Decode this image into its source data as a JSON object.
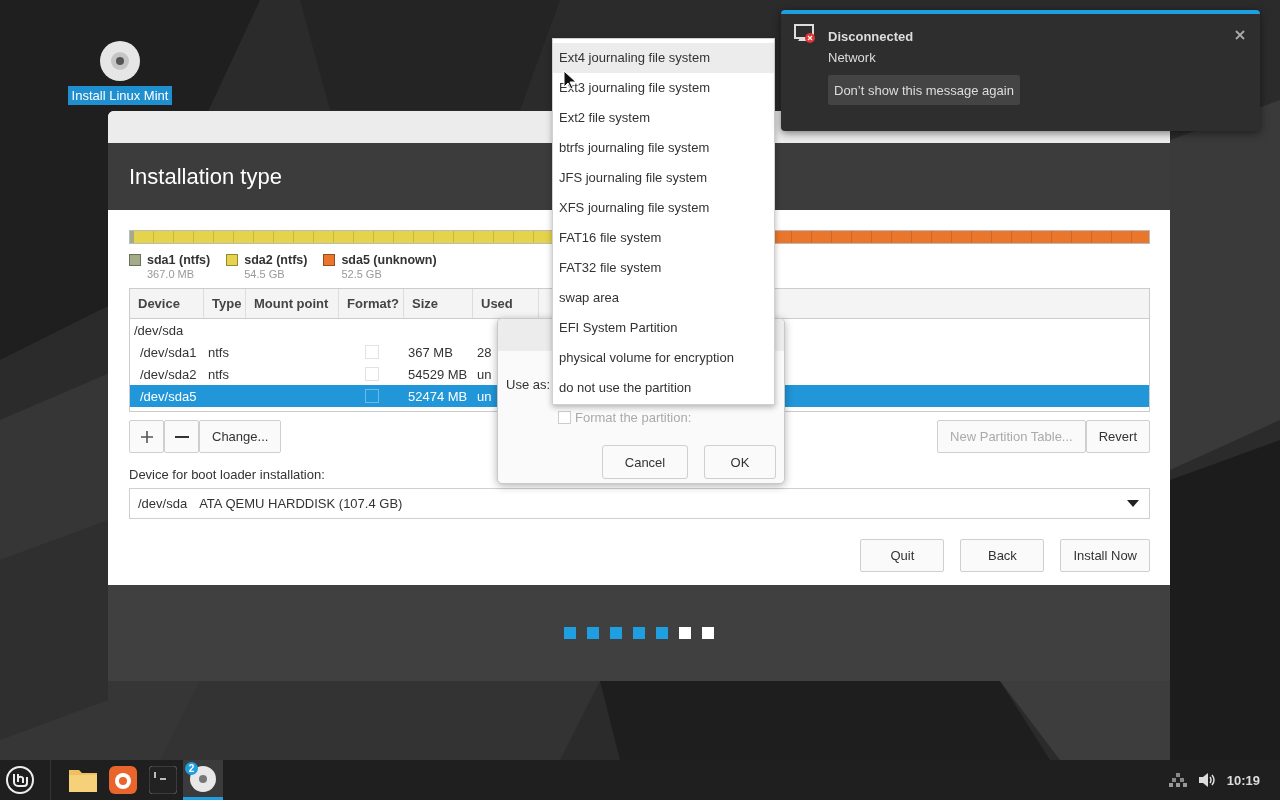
{
  "desktop_icon": {
    "label": "Install Linux Mint",
    "selected": true
  },
  "installer": {
    "title": "Installation type",
    "partitions": [
      {
        "name": "sda1 (ntfs)",
        "size": "367.0 MB",
        "color": "#a4ab8b",
        "level": 0.004
      },
      {
        "name": "sda2 (ntfs)",
        "size": "54.5 GB",
        "color": "#e4d34b",
        "level": 0.508
      },
      {
        "name": "sda5 (unknown)",
        "size": "52.5 GB",
        "color": "#e9762b",
        "level": 0.488
      }
    ],
    "table": {
      "columns": [
        "Device",
        "Type",
        "Mount point",
        "Format?",
        "Size",
        "Used"
      ],
      "rows": [
        {
          "kind": "disk",
          "device": "/dev/sda",
          "selected": false
        },
        {
          "kind": "partition",
          "device": "/dev/sda1",
          "type": "ntfs",
          "format": false,
          "size": "367 MB",
          "used": "28",
          "selected": false
        },
        {
          "kind": "partition",
          "device": "/dev/sda2",
          "type": "ntfs",
          "format": false,
          "size": "54529 MB",
          "used": "un",
          "selected": false
        },
        {
          "kind": "partition",
          "device": "/dev/sda5",
          "format": false,
          "size": "52474 MB",
          "used": "un",
          "selected": true
        }
      ]
    },
    "tools": [
      {
        "kind": "add"
      },
      {
        "kind": "remove"
      },
      {
        "kind": "text",
        "label": "Change...",
        "disabled": false
      }
    ],
    "table_buttons": [
      {
        "label": "New Partition Table...",
        "disabled": true
      },
      {
        "label": "Revert",
        "disabled": false
      }
    ],
    "bootloader": {
      "label": "Device for boot loader installation:",
      "device": "/dev/sda",
      "description": "ATA QEMU HARDDISK (107.4 GB)"
    },
    "buttons": [
      "Quit",
      "Back",
      "Install Now"
    ],
    "steps": [
      {
        "done": true
      },
      {
        "done": true
      },
      {
        "done": true
      },
      {
        "done": true
      },
      {
        "done": true
      },
      {
        "done": false
      },
      {
        "done": false
      }
    ]
  },
  "dialog": {
    "label": "Use as:",
    "format": {
      "label": "Format the partition:",
      "checked": false,
      "disabled": true
    },
    "buttons": [
      "Cancel",
      "OK"
    ]
  },
  "menu": {
    "items": [
      {
        "label": "Ext4 journaling file system",
        "selected": true
      },
      {
        "label": "Ext3 journaling file system",
        "selected": false
      },
      {
        "label": "Ext2 file system",
        "selected": false
      },
      {
        "label": "btrfs journaling file system",
        "selected": false
      },
      {
        "label": "JFS journaling file system",
        "selected": false
      },
      {
        "label": "XFS journaling file system",
        "selected": false
      },
      {
        "label": "FAT16 file system",
        "selected": false
      },
      {
        "label": "FAT32 file system",
        "selected": false
      },
      {
        "label": "swap area",
        "selected": false
      },
      {
        "label": "EFI System Partition",
        "selected": false
      },
      {
        "label": "physical volume for encryption",
        "selected": false
      },
      {
        "label": "do not use the partition",
        "selected": false
      }
    ]
  },
  "notification": {
    "title": "Disconnected",
    "body": "Network",
    "button": "Don’t show this message again"
  },
  "taskbar": {
    "launchers": [
      {
        "kind": "menu",
        "active": false
      },
      {
        "kind": "files",
        "active": false
      },
      {
        "kind": "browser",
        "active": false
      },
      {
        "kind": "terminal",
        "active": false
      },
      {
        "kind": "installer",
        "active": true,
        "badge": "2"
      }
    ],
    "clock": "10:19"
  }
}
